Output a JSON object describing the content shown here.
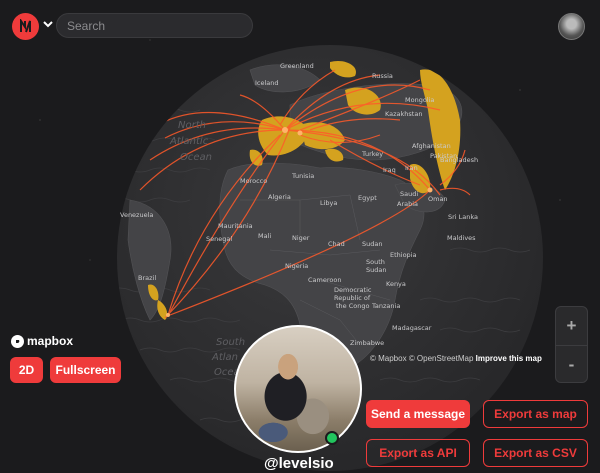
{
  "header": {
    "search_placeholder": "Search",
    "logo_icon": "nomads-logo-icon",
    "menu_icon": "chevron-down-icon"
  },
  "map": {
    "labels": [
      {
        "text": "Greenland"
      },
      {
        "text": "Iceland"
      },
      {
        "text": "Russia"
      },
      {
        "text": "Mongolia"
      },
      {
        "text": "Kazakhstan"
      },
      {
        "text": "North"
      },
      {
        "text": "Atlantic"
      },
      {
        "text": "Ocean"
      },
      {
        "text": "Turkey"
      },
      {
        "text": "Iraq"
      },
      {
        "text": "Iran"
      },
      {
        "text": "Afghanistan"
      },
      {
        "text": "Pakistan"
      },
      {
        "text": "Bangladesh"
      },
      {
        "text": "Morocco"
      },
      {
        "text": "Tunisia"
      },
      {
        "text": "Algeria"
      },
      {
        "text": "Libya"
      },
      {
        "text": "Egypt"
      },
      {
        "text": "Saudi"
      },
      {
        "text": "Arabia"
      },
      {
        "text": "Oman"
      },
      {
        "text": "Venezuela"
      },
      {
        "text": "Mauritania"
      },
      {
        "text": "Mali"
      },
      {
        "text": "Niger"
      },
      {
        "text": "Chad"
      },
      {
        "text": "Sudan"
      },
      {
        "text": "Senegal"
      },
      {
        "text": "Ethiopia"
      },
      {
        "text": "Nigeria"
      },
      {
        "text": "South"
      },
      {
        "text": "Sudan"
      },
      {
        "text": "Sri Lanka"
      },
      {
        "text": "Maldives"
      },
      {
        "text": "Brazil"
      },
      {
        "text": "Cameroon"
      },
      {
        "text": "Democratic"
      },
      {
        "text": "Republic of"
      },
      {
        "text": "the Congo"
      },
      {
        "text": "Kenya"
      },
      {
        "text": "Tanzania"
      },
      {
        "text": "Madagascar"
      },
      {
        "text": "Zimbabwe"
      },
      {
        "text": "South"
      },
      {
        "text": "Atlan"
      },
      {
        "text": "Ocea"
      }
    ]
  },
  "mapbox": {
    "logo_text": "mapbox",
    "attribution_mapbox": "© Mapbox",
    "attribution_osm": "© OpenStreetMap",
    "improve_link": "Improve this map"
  },
  "controls": {
    "view_2d": "2D",
    "fullscreen": "Fullscreen",
    "zoom_in": "+",
    "zoom_out": "-"
  },
  "profile": {
    "handle": "@levelsio",
    "status": "online"
  },
  "actions": {
    "send_message": "Send a message",
    "export_map": "Export as map",
    "export_api": "Export as API",
    "export_csv": "Export as CSV"
  },
  "colors": {
    "accent": "#ef3b3b",
    "visited": "#d4a21f",
    "route": "#ff5a2a",
    "online": "#22c55e"
  }
}
